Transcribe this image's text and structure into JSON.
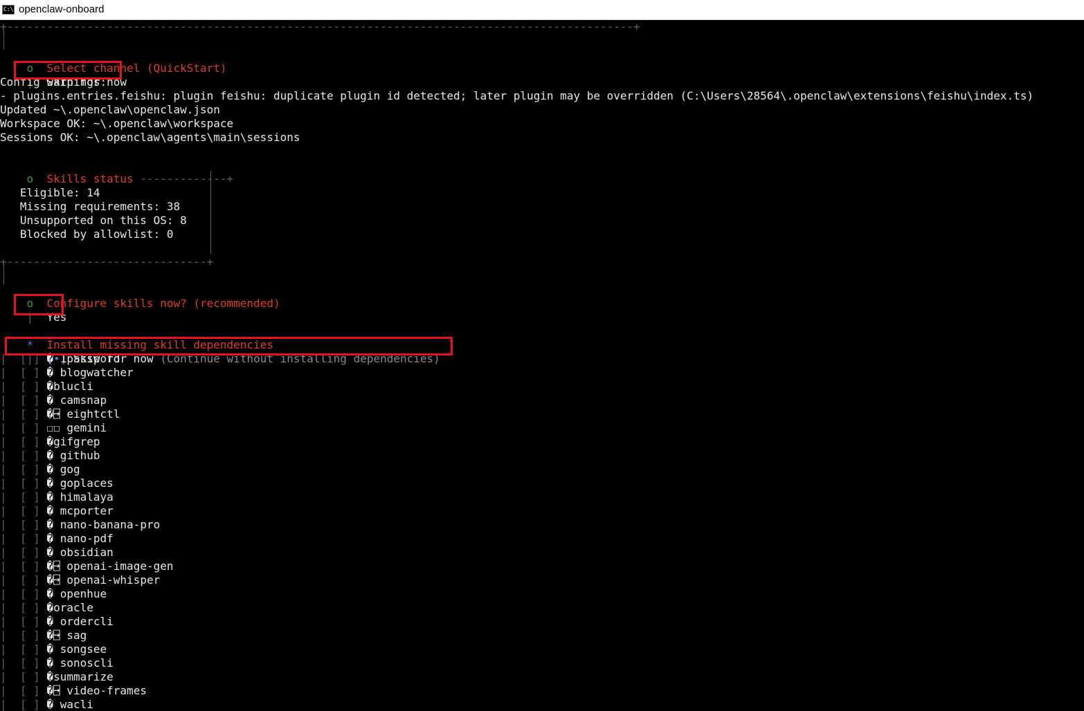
{
  "window": {
    "title": "openclaw-onboard",
    "icon": "cmd-icon"
  },
  "top_border": "+----------------------------------------------------------------------------------------------+",
  "select_channel": {
    "bullet": "o",
    "title": "Select channel (QuickStart)",
    "choice": "Skip for now"
  },
  "config_warnings": {
    "header": "Config warnings:",
    "message": "- plugins.entries.feishu: plugin feishu: duplicate plugin id detected; later plugin may be overridden (C:\\Users\\28564\\.openclaw\\extensions\\feishu\\index.ts)"
  },
  "status_lines": [
    "Updated ~\\.openclaw\\openclaw.json",
    "Workspace OK: ~\\.openclaw\\workspace",
    "Sessions OK: ~\\.openclaw\\agents\\main\\sessions"
  ],
  "skills_status": {
    "bullet": "o",
    "title": "Skills status",
    "rule": "-------------+",
    "bottom": "+------------------------------+",
    "lines": [
      "Eligible: 14",
      "Missing requirements: 38",
      "Unsupported on this OS: 8",
      "Blocked by allowlist: 0"
    ]
  },
  "configure_skills": {
    "bullet": "o",
    "title": "Configure skills now? (recommended)",
    "choice": "Yes"
  },
  "install_deps": {
    "bullet": "*",
    "title": "Install missing skill dependencies",
    "selected": {
      "box": "[•]",
      "label": "Skip for now",
      "hint": "(Continue without installing dependencies)"
    },
    "items": [
      {
        "box": "[ ]",
        "icon": "� ",
        "label": "1password"
      },
      {
        "box": "[ ]",
        "icon": "� ",
        "label": "blogwatcher"
      },
      {
        "box": "[ ]",
        "icon": "�",
        "label": "blucli"
      },
      {
        "box": "[ ]",
        "icon": "� ",
        "label": "camsnap"
      },
      {
        "box": "[ ]",
        "icon": "�⍈ ",
        "label": "eightctl"
      },
      {
        "box": "[ ]",
        "icon": "☐☐ ",
        "label": "gemini"
      },
      {
        "box": "[ ]",
        "icon": "�",
        "label": "gifgrep"
      },
      {
        "box": "[ ]",
        "icon": "� ",
        "label": "github"
      },
      {
        "box": "[ ]",
        "icon": "� ",
        "label": "gog"
      },
      {
        "box": "[ ]",
        "icon": "� ",
        "label": "goplaces"
      },
      {
        "box": "[ ]",
        "icon": "� ",
        "label": "himalaya"
      },
      {
        "box": "[ ]",
        "icon": "� ",
        "label": "mcporter"
      },
      {
        "box": "[ ]",
        "icon": "� ",
        "label": "nano-banana-pro"
      },
      {
        "box": "[ ]",
        "icon": "� ",
        "label": "nano-pdf"
      },
      {
        "box": "[ ]",
        "icon": "� ",
        "label": "obsidian"
      },
      {
        "box": "[ ]",
        "icon": "�⍈ ",
        "label": "openai-image-gen"
      },
      {
        "box": "[ ]",
        "icon": "�⍈ ",
        "label": "openai-whisper"
      },
      {
        "box": "[ ]",
        "icon": "� ",
        "label": "openhue"
      },
      {
        "box": "[ ]",
        "icon": "�",
        "label": "oracle"
      },
      {
        "box": "[ ]",
        "icon": "� ",
        "label": "ordercli"
      },
      {
        "box": "[ ]",
        "icon": "�⍈ ",
        "label": "sag"
      },
      {
        "box": "[ ]",
        "icon": "� ",
        "label": "songsee"
      },
      {
        "box": "[ ]",
        "icon": "� ",
        "label": "sonoscli"
      },
      {
        "box": "[ ]",
        "icon": "�",
        "label": "summarize"
      },
      {
        "box": "[ ]",
        "icon": "�⍈ ",
        "label": "video-frames"
      },
      {
        "box": "[ ]",
        "icon": "� ",
        "label": "wacli"
      }
    ]
  }
}
